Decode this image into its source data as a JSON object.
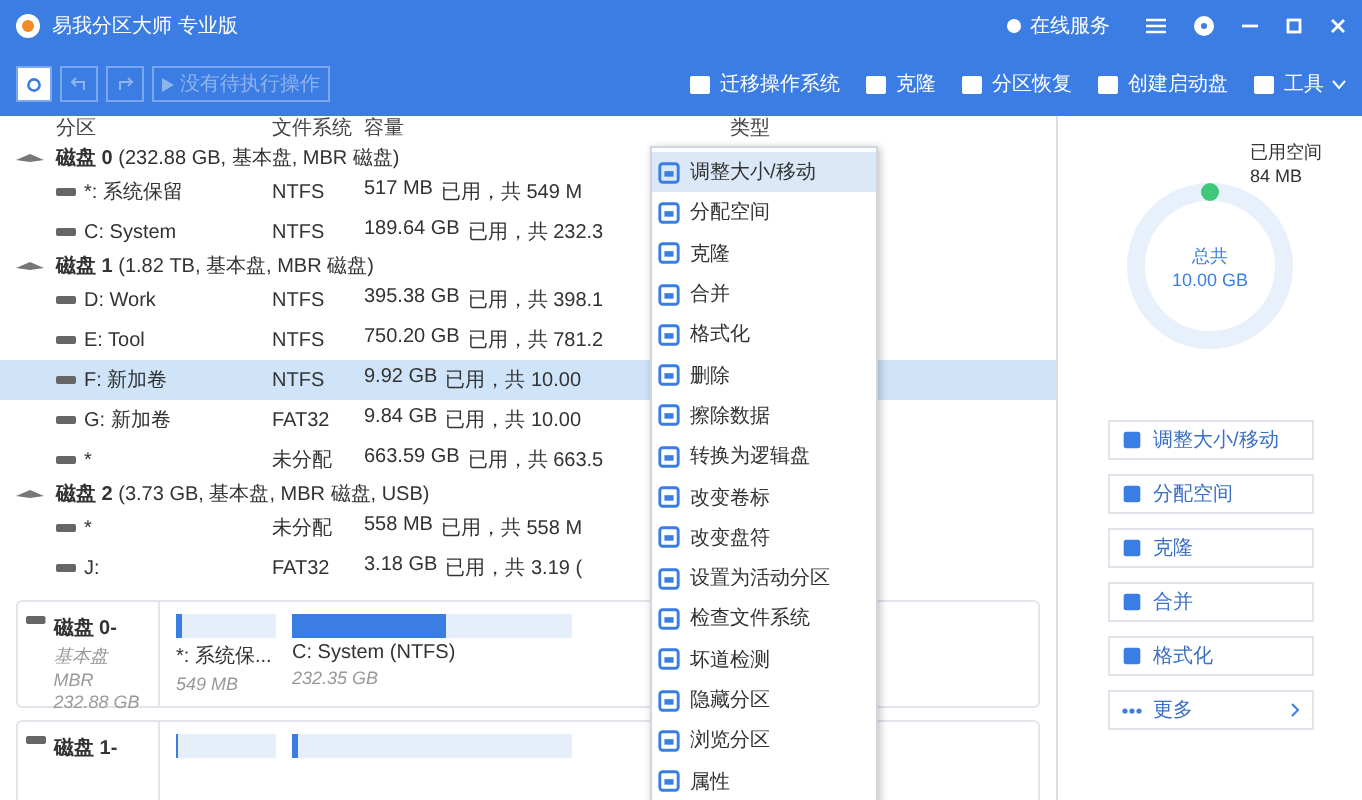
{
  "window": {
    "title": "易我分区大师 专业版",
    "online_service": "在线服务"
  },
  "toolbar": {
    "pending": {
      "label": "没有待执行操作",
      "disabled": true
    },
    "actions": [
      {
        "label": "迁移操作系统"
      },
      {
        "label": "克隆"
      },
      {
        "label": "分区恢复"
      },
      {
        "label": "创建启动盘"
      },
      {
        "label": "工具",
        "dropdown": true
      }
    ]
  },
  "table": {
    "columns": [
      "分区",
      "文件系统",
      "容量",
      "类型"
    ],
    "disks": [
      {
        "name": "磁盘 0",
        "info": "(232.88 GB, 基本盘, MBR 磁盘)",
        "children": [
          {
            "name": "*: 系统保留",
            "fs": "NTFS",
            "capacity": "517 MB",
            "usage": "已用，共 549 M",
            "selected": false
          },
          {
            "name": "C: System",
            "fs": "NTFS",
            "capacity": "189.64 GB",
            "usage": "已用，共 232.3",
            "selected": false
          }
        ]
      },
      {
        "name": "磁盘 1",
        "info": "(1.82 TB, 基本盘, MBR 磁盘)",
        "children": [
          {
            "name": "D: Work",
            "fs": "NTFS",
            "capacity": "395.38 GB",
            "usage": "已用，共 398.1",
            "selected": false
          },
          {
            "name": "E: Tool",
            "fs": "NTFS",
            "capacity": "750.20 GB",
            "usage": "已用，共 781.2",
            "selected": false
          },
          {
            "name": "F: 新加卷",
            "fs": "NTFS",
            "capacity": "9.92 GB",
            "usage": "已用，共 10.00",
            "selected": true
          },
          {
            "name": "G: 新加卷",
            "fs": "FAT32",
            "capacity": "9.84 GB",
            "usage": "已用，共 10.00",
            "selected": false
          },
          {
            "name": "*",
            "fs": "未分配",
            "capacity": "663.59 GB",
            "usage": "已用，共 663.5",
            "selected": false
          }
        ]
      },
      {
        "name": "磁盘 2",
        "info": "(3.73 GB, 基本盘, MBR 磁盘, USB)",
        "children": [
          {
            "name": "*",
            "fs": "未分配",
            "capacity": "558 MB",
            "usage": "已用，共 558 M",
            "selected": false
          },
          {
            "name": "J:",
            "fs": "FAT32",
            "capacity": "3.18 GB",
            "usage": "已用，共 3.19 (",
            "selected": false
          }
        ]
      }
    ]
  },
  "disk_map": [
    {
      "name": "磁盘 0-",
      "type": "基本盘 MBR",
      "size": "232.88 GB",
      "segments": [
        {
          "label": "*: 系统保...",
          "size": "549 MB",
          "level": 0.05
        },
        {
          "label": "C: System (NTFS)",
          "size": "232.35 GB",
          "level": 0.55
        }
      ]
    },
    {
      "name": "磁盘 1-",
      "segments": [
        {
          "level": 0.02
        },
        {
          "level": 0.02
        }
      ]
    }
  ],
  "context_menu": [
    {
      "label": "调整大小/移动",
      "selected": true
    },
    {
      "label": "分配空间",
      "selected": false
    },
    {
      "label": "克隆",
      "selected": false
    },
    {
      "label": "合并",
      "selected": false
    },
    {
      "label": "格式化",
      "selected": false
    },
    {
      "label": "删除",
      "selected": false
    },
    {
      "label": "擦除数据",
      "selected": false
    },
    {
      "label": "转换为逻辑盘",
      "selected": false
    },
    {
      "label": "改变卷标",
      "selected": false
    },
    {
      "label": "改变盘符",
      "selected": false
    },
    {
      "label": "设置为活动分区",
      "selected": false
    },
    {
      "label": "检查文件系统",
      "selected": false
    },
    {
      "label": "坏道检测",
      "selected": false
    },
    {
      "label": "隐藏分区",
      "selected": false
    },
    {
      "label": "浏览分区",
      "selected": false
    },
    {
      "label": "属性",
      "selected": false
    }
  ],
  "side_panel": {
    "used_label": "已用空间",
    "used_value": "84 MB",
    "total_label": "总共",
    "total_value": "10.00 GB",
    "buttons": [
      {
        "label": "调整大小/移动"
      },
      {
        "label": "分配空间"
      },
      {
        "label": "克隆"
      },
      {
        "label": "合并"
      },
      {
        "label": "格式化"
      },
      {
        "label": "更多",
        "more": true
      }
    ]
  }
}
